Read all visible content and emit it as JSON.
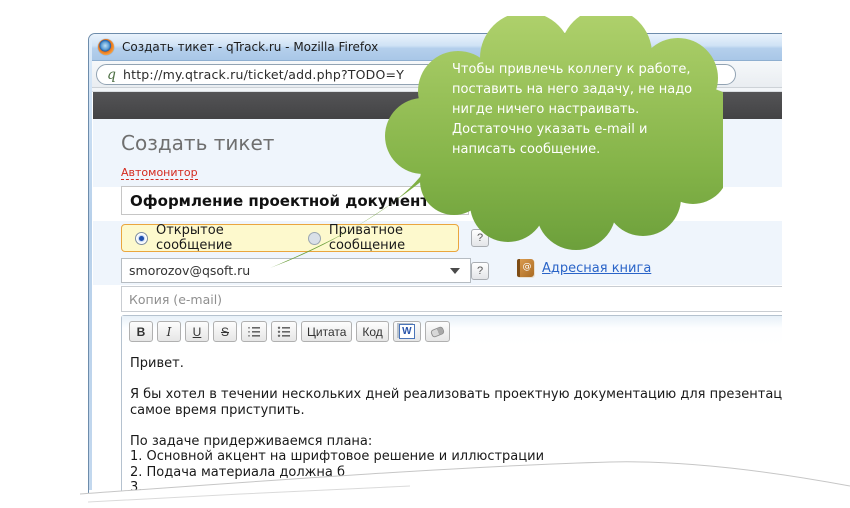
{
  "window": {
    "title": "Создать тикет - qTrack.ru - Mozilla Firefox"
  },
  "browser": {
    "url": "http://my.qtrack.ru/ticket/add.php?TODO=Y",
    "favicon_glyph": "q"
  },
  "page": {
    "heading": "Создать тикет",
    "automonitor_link": "Автомонитор",
    "ticket_title_value": "Оформление проектной документации",
    "visibility": {
      "open_label": "Открытое сообщение",
      "private_label": "Приватное сообщение",
      "help_label": "?"
    },
    "recipient": {
      "value": "smorozov@qsoft.ru",
      "help_label": "?",
      "address_book_icon": "@",
      "address_book_label": "Адресная книга"
    },
    "copy_placeholder": "Копия (e-mail)",
    "editor": {
      "toolbar": {
        "bold": "B",
        "italic": "I",
        "underline": "U",
        "strike": "S",
        "quote": "Цитата",
        "code": "Код"
      },
      "message_lines": [
        "Привет.",
        "",
        "Я бы хотел в течении нескольких дней реализовать проектную документацию для презентации. Это то, что м",
        "самое время приступить.",
        "",
        "По задаче придерживаемся плана:",
        "1. Основной акцент на шрифтовое решение и иллюстрации",
        "2. Подача материала должна б",
        "3."
      ]
    }
  },
  "tooltip": {
    "lines": [
      "Чтобы привлечь коллегу к работе,",
      "поставить на него задачу, не надо",
      "нигде ничего настраивать.",
      "Достаточно указать e-mail и",
      "написать сообщение."
    ]
  },
  "colors": {
    "cloud_green_top": "#aed06b",
    "cloud_green_bottom": "#629735",
    "band_blue": "#eff5fc",
    "radio_box_yellow": "#fdf9cd",
    "radio_box_border": "#eaa63e",
    "automonitor_red": "#d42a1e",
    "link_blue": "#2a64c8",
    "darkbar": "#48484a"
  }
}
